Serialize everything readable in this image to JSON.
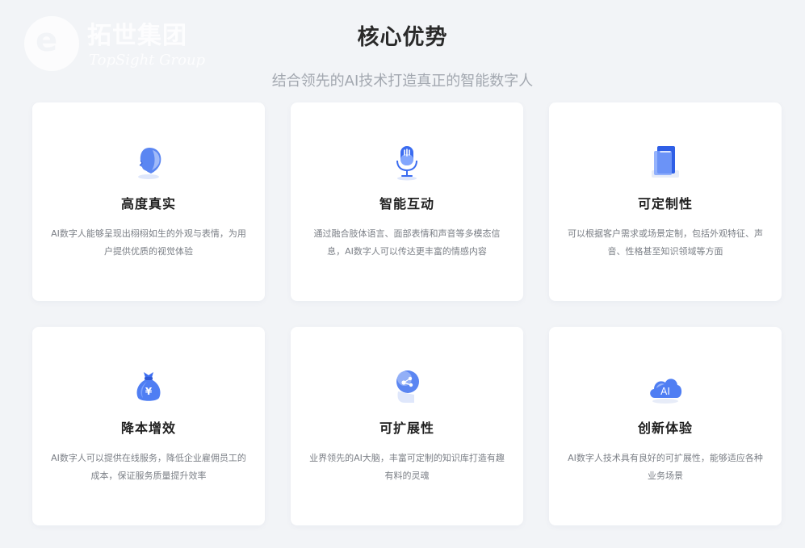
{
  "header": {
    "title": "核心优势",
    "subtitle": "结合领先的AI技术打造真正的智能数字人"
  },
  "watermark": {
    "brand_cn": "拓世集团",
    "brand_en": "TopSight Group"
  },
  "colors": {
    "accent": "#3b6cf0",
    "accent_light": "#8fb0ff",
    "background": "#f2f4f7"
  },
  "cards": [
    {
      "title": "高度真实",
      "desc": "AI数字人能够呈现出栩栩如生的外观与表情，为用户提供优质的视觉体验",
      "icon": "head-profile-icon"
    },
    {
      "title": "智能互动",
      "desc": "通过融合肢体语言、面部表情和声音等多模态信息，AI数字人可以传达更丰富的情感内容",
      "icon": "microphone-icon"
    },
    {
      "title": "可定制性",
      "desc": "可以根据客户需求或场景定制，包括外观特征、声音、性格甚至知识领域等方面",
      "icon": "document-icon"
    },
    {
      "title": "降本增效",
      "desc": "AI数字人可以提供在线服务，降低企业雇佣员工的成本，保证服务质量提升效率",
      "icon": "money-bag-icon"
    },
    {
      "title": "可扩展性",
      "desc": "业界领先的AI大脑，丰富可定制的知识库打造有趣有料的灵魂",
      "icon": "brain-network-icon"
    },
    {
      "title": "创新体验",
      "desc": "AI数字人技术具有良好的可扩展性，能够适应各种业务场景",
      "icon": "ai-cloud-icon"
    }
  ]
}
